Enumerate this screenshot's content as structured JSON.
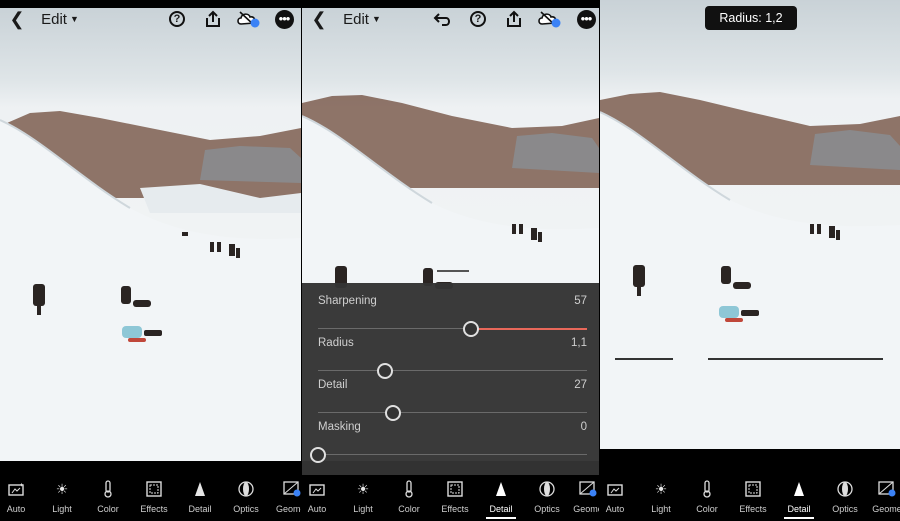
{
  "panels": [
    {
      "topbar": {
        "edit_label": "Edit"
      },
      "tools": [
        {
          "label": "Auto",
          "icon": "auto-icon"
        },
        {
          "label": "Light",
          "icon": "sun-icon"
        },
        {
          "label": "Color",
          "icon": "thermometer-icon"
        },
        {
          "label": "Effects",
          "icon": "effects-icon"
        },
        {
          "label": "Detail",
          "icon": "triangle-icon"
        },
        {
          "label": "Optics",
          "icon": "lens-icon"
        },
        {
          "label": "Geomet",
          "icon": "geometry-icon"
        }
      ],
      "active_tool": ""
    },
    {
      "topbar": {
        "edit_label": "Edit"
      },
      "detail": {
        "sliders": [
          {
            "label": "Sharpening",
            "value": "57",
            "level": 0.57
          },
          {
            "label": "Radius",
            "value": "1,1",
            "level": 0.25
          },
          {
            "label": "Detail",
            "value": "27",
            "level": 0.28
          },
          {
            "label": "Masking",
            "value": "0",
            "level": 0.0
          }
        ]
      },
      "tools": [
        {
          "label": "Auto",
          "icon": "auto-icon"
        },
        {
          "label": "Light",
          "icon": "sun-icon"
        },
        {
          "label": "Color",
          "icon": "thermometer-icon"
        },
        {
          "label": "Effects",
          "icon": "effects-icon"
        },
        {
          "label": "Detail",
          "icon": "triangle-icon"
        },
        {
          "label": "Optics",
          "icon": "lens-icon"
        },
        {
          "label": "Geome",
          "icon": "geometry-icon"
        }
      ],
      "active_tool": "Detail"
    },
    {
      "tooltip": "Radius: 1,2",
      "tools": [
        {
          "label": "Auto",
          "icon": "auto-icon"
        },
        {
          "label": "Light",
          "icon": "sun-icon"
        },
        {
          "label": "Color",
          "icon": "thermometer-icon"
        },
        {
          "label": "Effects",
          "icon": "effects-icon"
        },
        {
          "label": "Detail",
          "icon": "triangle-icon"
        },
        {
          "label": "Optics",
          "icon": "lens-icon"
        },
        {
          "label": "Geome",
          "icon": "geometry-icon"
        }
      ],
      "active_tool": "Detail"
    }
  ],
  "colors": {
    "slider_fill": "#e8685a",
    "cloud_badge": "#3b82f6"
  }
}
